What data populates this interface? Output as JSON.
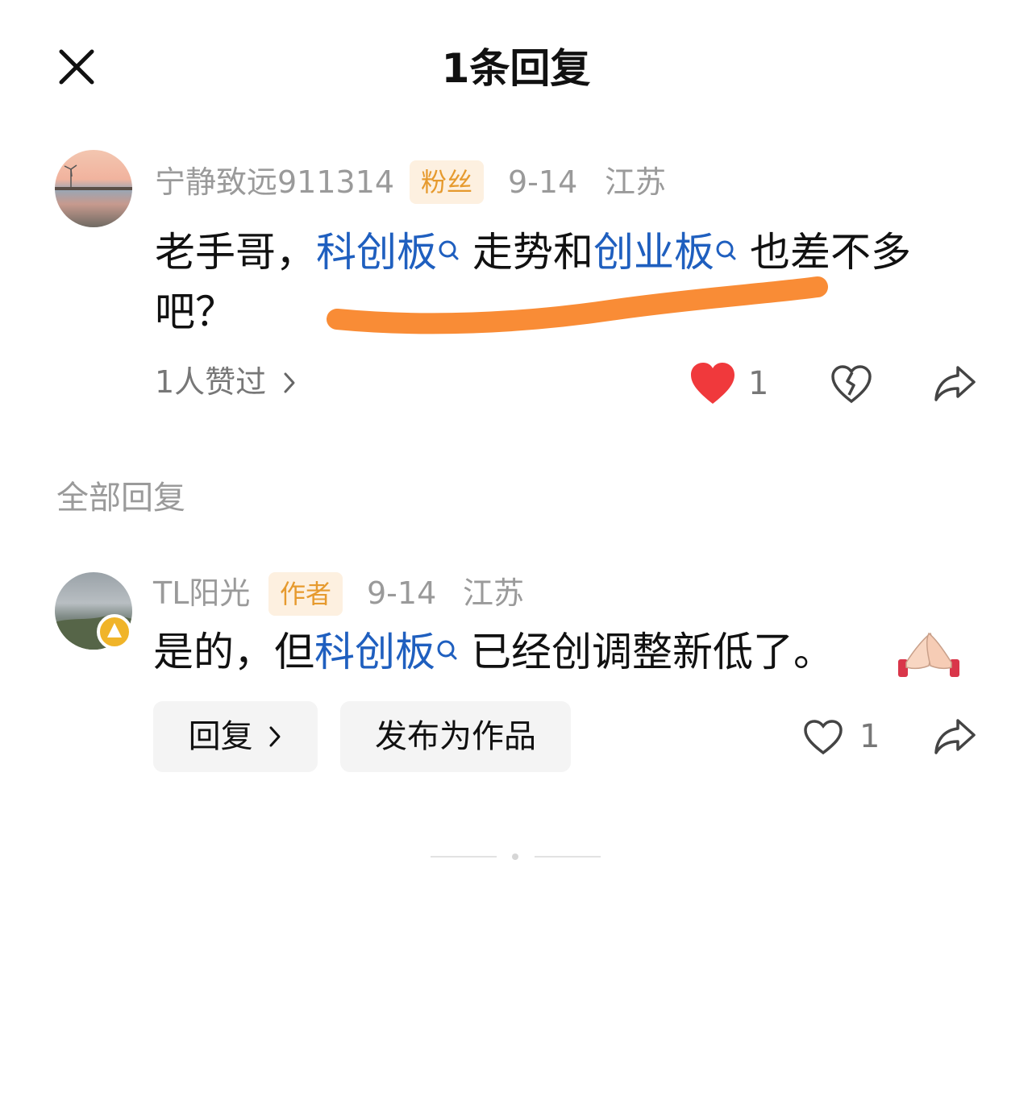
{
  "header": {
    "title": "1条回复"
  },
  "comment": {
    "username": "宁静致远911314",
    "badge": "粉丝",
    "date": "9-14",
    "location": "江苏",
    "text_part1": "老手哥，",
    "link1": "科创板",
    "text_part2": "走势和",
    "link2": "创业板",
    "text_part3": "也差不多",
    "text_line2": "吧？",
    "likes_summary": "1人赞过",
    "like_count": "1"
  },
  "section": {
    "title": "全部回复"
  },
  "reply": {
    "username": "TL阳光",
    "badge": "作者",
    "date": "9-14",
    "location": "江苏",
    "text_part1": "是的，但",
    "link1": "科创板",
    "text_part2": "已经创调整新低了。",
    "reply_button": "回复",
    "publish_button": "发布为作品",
    "like_count": "1"
  },
  "colors": {
    "link": "#1f5fbf",
    "badge_bg": "#fdf0e0",
    "badge_text": "#e69a2e",
    "liked_heart": "#f0393c",
    "highlight_stroke": "#f98c36"
  }
}
